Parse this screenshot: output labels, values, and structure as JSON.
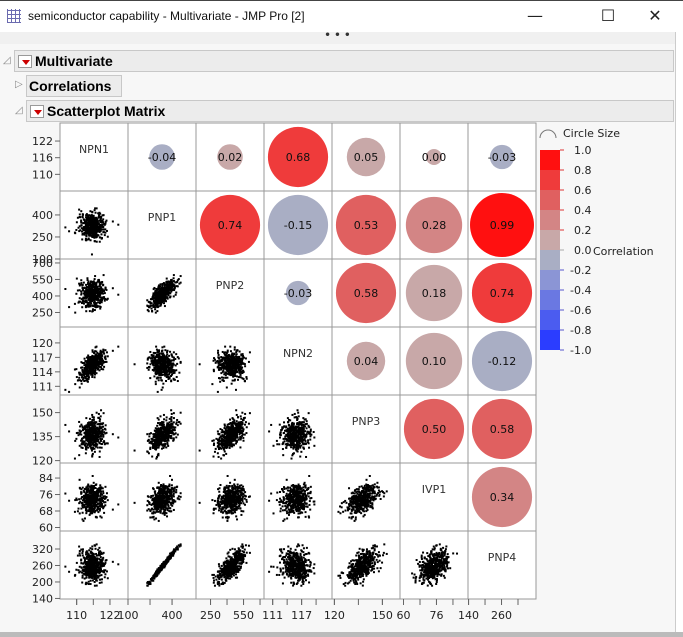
{
  "window": {
    "title": "semiconductor capability - Multivariate - JMP Pro [2]",
    "minimize": "—",
    "maximize": "☐",
    "close": "✕",
    "more": "• • •"
  },
  "sections": {
    "multivariate": "Multivariate",
    "correlations": "Correlations",
    "scatterplot_matrix": "Scatterplot Matrix"
  },
  "legend": {
    "title": "Circle Size",
    "axis_label": "Correlation",
    "ticks": [
      "1.0",
      "0.8",
      "0.6",
      "0.4",
      "0.2",
      "0.0",
      "-0.2",
      "-0.4",
      "-0.6",
      "-0.8",
      "-1.0"
    ],
    "band_colors": [
      "#ff1010",
      "#ef3b3b",
      "#e06060",
      "#d38585",
      "#c8a8a8",
      "#a9aec4",
      "#8b95d5",
      "#6a78e2",
      "#4b5cf0",
      "#2b3dff"
    ]
  },
  "chart_data": {
    "type": "scatterplot-matrix",
    "variables": [
      "NPN1",
      "PNP1",
      "PNP2",
      "NPN2",
      "PNP3",
      "IVP1",
      "PNP4"
    ],
    "ranges": [
      [
        104,
        128.5
      ],
      [
        100,
        563
      ],
      [
        118,
        736
      ],
      [
        109.2,
        123.3
      ],
      [
        118.5,
        161
      ],
      [
        58.3,
        91.3
      ],
      [
        138,
        385.5
      ]
    ],
    "y_ticks": [
      [
        "122",
        "116",
        "110"
      ],
      [
        "400",
        "250",
        "100"
      ],
      [
        "700",
        "550",
        "400",
        "250"
      ],
      [
        "120",
        "117",
        "114",
        "111"
      ],
      [
        "150",
        "135",
        "120"
      ],
      [
        "84",
        "76",
        "68",
        "60"
      ],
      [
        "320",
        "260",
        "200",
        "140"
      ]
    ],
    "x_ticks": [
      [
        "110",
        "122"
      ],
      [
        "100",
        "400"
      ],
      [
        "250",
        "550"
      ],
      [
        "111",
        "117"
      ],
      [
        "120",
        "150"
      ],
      [
        "60",
        "76"
      ],
      [
        "140",
        "260"
      ]
    ],
    "correlations": [
      {
        "row": 0,
        "col": 1,
        "label": "-0.04",
        "value": -0.04,
        "circle_size": 0.4
      },
      {
        "row": 0,
        "col": 2,
        "label": "0.02",
        "value": 0.02,
        "circle_size": 0.4
      },
      {
        "row": 0,
        "col": 3,
        "label": "0.68",
        "value": 0.68,
        "circle_size": 0.94
      },
      {
        "row": 0,
        "col": 4,
        "label": "0.05",
        "value": 0.05,
        "circle_size": 0.6
      },
      {
        "row": 0,
        "col": 5,
        "label": "0.00",
        "value": 0.0,
        "circle_size": 0.25
      },
      {
        "row": 0,
        "col": 6,
        "label": "-0.03",
        "value": -0.03,
        "circle_size": 0.38
      },
      {
        "row": 1,
        "col": 2,
        "label": "0.74",
        "value": 0.74,
        "circle_size": 0.94
      },
      {
        "row": 1,
        "col": 3,
        "label": "-0.15",
        "value": -0.15,
        "circle_size": 0.94
      },
      {
        "row": 1,
        "col": 4,
        "label": "0.53",
        "value": 0.53,
        "circle_size": 0.94
      },
      {
        "row": 1,
        "col": 5,
        "label": "0.28",
        "value": 0.28,
        "circle_size": 0.88
      },
      {
        "row": 1,
        "col": 6,
        "label": "0.99",
        "value": 0.99,
        "circle_size": 1.0
      },
      {
        "row": 2,
        "col": 3,
        "label": "-0.03",
        "value": -0.03,
        "circle_size": 0.38
      },
      {
        "row": 2,
        "col": 4,
        "label": "0.58",
        "value": 0.58,
        "circle_size": 0.94
      },
      {
        "row": 2,
        "col": 5,
        "label": "0.18",
        "value": 0.18,
        "circle_size": 0.88
      },
      {
        "row": 2,
        "col": 6,
        "label": "0.74",
        "value": 0.74,
        "circle_size": 0.94
      },
      {
        "row": 3,
        "col": 4,
        "label": "0.04",
        "value": 0.04,
        "circle_size": 0.6
      },
      {
        "row": 3,
        "col": 5,
        "label": "0.10",
        "value": 0.1,
        "circle_size": 0.88
      },
      {
        "row": 3,
        "col": 6,
        "label": "-0.12",
        "value": -0.12,
        "circle_size": 0.94
      },
      {
        "row": 4,
        "col": 5,
        "label": "0.50",
        "value": 0.5,
        "circle_size": 0.94
      },
      {
        "row": 4,
        "col": 6,
        "label": "0.58",
        "value": 0.58,
        "circle_size": 0.94
      },
      {
        "row": 5,
        "col": 6,
        "label": "0.34",
        "value": 0.34,
        "circle_size": 0.94
      }
    ]
  }
}
